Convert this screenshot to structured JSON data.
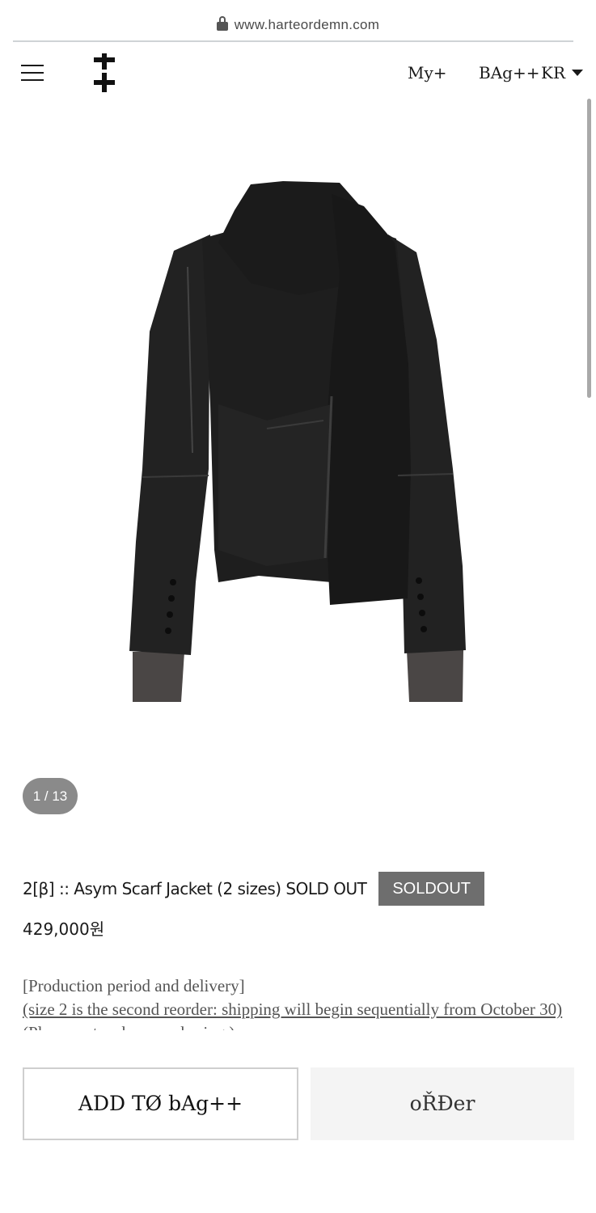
{
  "browser": {
    "url": "www.harteordemn.com"
  },
  "header": {
    "my_label": "My+",
    "bag_label": "BAg++",
    "lang_label": "KR"
  },
  "gallery": {
    "counter": "1 / 13"
  },
  "product": {
    "title": "2[β] :: Asym Scarf Jacket (2 sizes) SOLD OUT",
    "badge": "SOLDOUT",
    "price": "429,000원"
  },
  "description": {
    "heading": "[Production period and delivery]",
    "notice": "(size 2 is the second reorder: shipping will begin sequentially from October 30)",
    "note_partial": "(Please note when purchasing.)"
  },
  "actions": {
    "add_to_bag": "ADD TØ bAg++",
    "order": "oŘĐer"
  },
  "colors": {
    "badge_bg": "#6e6e6e",
    "counter_bg": "#8a8a8a",
    "order_bg": "#f4f4f4",
    "garment": "#1e1e1e",
    "cuff": "#4a4645"
  }
}
